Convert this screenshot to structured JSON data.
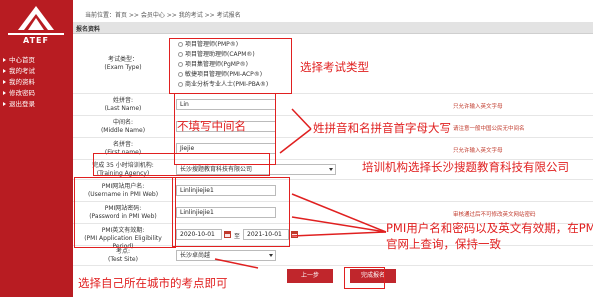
{
  "nav": {
    "items": [
      {
        "label": "中心首页"
      },
      {
        "label": "我的考试"
      },
      {
        "label": "我的资料"
      },
      {
        "label": "修改密码"
      },
      {
        "label": "退出登录"
      }
    ]
  },
  "breadcrumb": {
    "text": "当前位置：首页 >> 会员中心 >> 我的考试 >> 考试报名"
  },
  "main": {
    "title": "报名资料"
  },
  "exam_type": {
    "label_cn": "考试类型：",
    "label_en": "(Exam Type)",
    "options": [
      "项目管理师(PMP®)",
      "项目管理助理师(CAPM®)",
      "项目集管理师(PgMP®)",
      "敏捷项目管理师(PMI-ACP®)",
      "商业分析专业人士(PMI-PBA®)"
    ]
  },
  "last_name": {
    "label_cn": "姓拼音:",
    "label_en": "(Last Name)",
    "value": "Lin",
    "hint": "只允许输入英文字母"
  },
  "middle_name": {
    "label_cn": "中间名:",
    "label_en": "(Middle Name)",
    "value": "",
    "hint": "请注意一般中国公民无中间名"
  },
  "first_name": {
    "label_cn": "名拼音:",
    "label_en": "(First name)",
    "value": "Jiejie",
    "hint": "只允许输入英文字母"
  },
  "training": {
    "label_cn": "完成 35 小时培训机构:",
    "label_en": "(Training Agency)",
    "value": "长沙搜题教育科技有限公司"
  },
  "pmi_user": {
    "label_cn": "PMI网站用户名:",
    "label_en": "(Username in PMI Web)",
    "value": "Linlinjiejie1"
  },
  "pmi_pass": {
    "label_cn": "PMI网站密码:",
    "label_en": "(Password in PMI Web)",
    "value": "Linlinjiejie1",
    "hint": "审核通过后不可修改英文网站密码"
  },
  "validity": {
    "label_cn": "PMI英文有效期:",
    "label_en": "(PMI Application Eligibility Period)",
    "from": "2020-10-01",
    "sep": "至",
    "to": "2021-10-01"
  },
  "test_site": {
    "label_cn": "考点:",
    "label_en": "(Test Site)",
    "value": "长沙卓尚越"
  },
  "buttons": {
    "prev": "上一步",
    "done": "完成报名"
  },
  "annotations": {
    "exam_type": "选择考试类型",
    "middle": "不填写中间名",
    "names": "姓拼音和名拼音首字母大写",
    "training": "培训机构选择长沙搜题教育科技有限公司",
    "pmi_line1": "PMI用户名和密码以及英文有效期，在PMI",
    "pmi_line2": "官网上查询，保持一致",
    "site": "选择自己所在城市的考点即可"
  },
  "colors": {
    "brand": "#b81c22",
    "annotation": "#e02020"
  }
}
